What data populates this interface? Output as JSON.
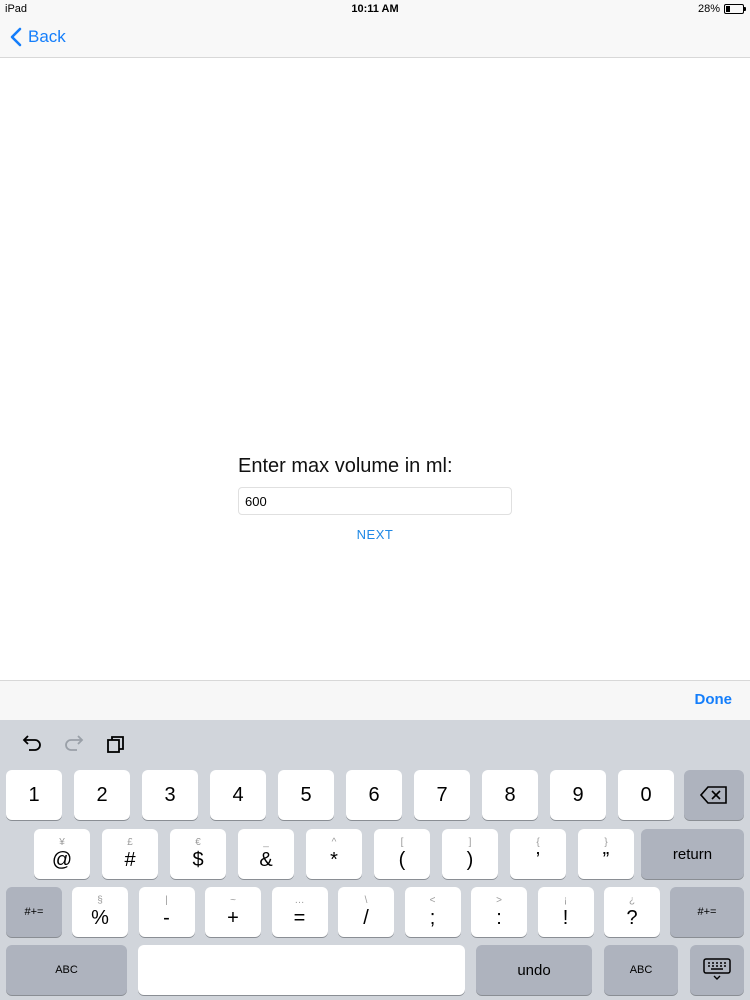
{
  "status_bar": {
    "device": "iPad",
    "time": "10:11 AM",
    "battery": "28%",
    "battery_level": 0.28
  },
  "nav": {
    "back_label": "Back"
  },
  "form": {
    "prompt": "Enter max volume in ml:",
    "volume_value": "600",
    "next_label": "NEXT"
  },
  "accessory": {
    "done_label": "Done"
  },
  "keyboard": {
    "row1": [
      "1",
      "2",
      "3",
      "4",
      "5",
      "6",
      "7",
      "8",
      "9",
      "0"
    ],
    "row2": [
      {
        "main": "@",
        "alt": "¥"
      },
      {
        "main": "#",
        "alt": "£"
      },
      {
        "main": "$",
        "alt": "€"
      },
      {
        "main": "&",
        "alt": "_"
      },
      {
        "main": "*",
        "alt": "^"
      },
      {
        "main": "(",
        "alt": "["
      },
      {
        "main": ")",
        "alt": "]"
      },
      {
        "main": "’",
        "alt": "{"
      },
      {
        "main": "”",
        "alt": "}"
      }
    ],
    "return_label": "return",
    "row3": [
      {
        "main": "%",
        "alt": "§"
      },
      {
        "main": "-",
        "alt": "|"
      },
      {
        "main": "+",
        "alt": "~"
      },
      {
        "main": "=",
        "alt": "…"
      },
      {
        "main": "/",
        "alt": "\\"
      },
      {
        "main": ";",
        "alt": "<"
      },
      {
        "main": ":",
        "alt": ">"
      },
      {
        "main": "!",
        "alt": "¡"
      },
      {
        "main": "?",
        "alt": "¿"
      }
    ],
    "symbols_label": "#+=",
    "abc_label": "ABC",
    "undo_label": "undo"
  }
}
